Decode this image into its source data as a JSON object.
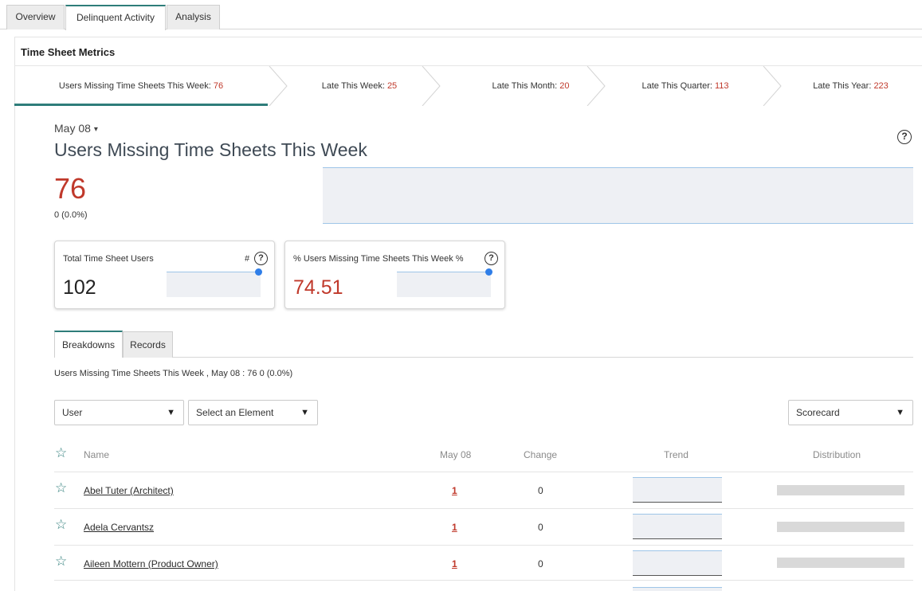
{
  "tabs": [
    "Overview",
    "Delinquent Activity",
    "Analysis"
  ],
  "panel_title": "Time Sheet Metrics",
  "metrics": [
    {
      "label": "Users Missing Time Sheets This Week: ",
      "value": "76"
    },
    {
      "label": "Late This Week: ",
      "value": "25"
    },
    {
      "label": "Late This Month: ",
      "value": "20"
    },
    {
      "label": "Late This Quarter: ",
      "value": "113"
    },
    {
      "label": "Late This Year: ",
      "value": "223"
    }
  ],
  "header": {
    "date": "May 08",
    "title": "Users Missing Time Sheets This Week",
    "value": "76",
    "change": "0 (0.0%)",
    "help": "?"
  },
  "cards": [
    {
      "label": "Total Time Sheet Users",
      "unit": "#",
      "value": "102"
    },
    {
      "label": "% Users Missing Time Sheets This Week %",
      "unit": "",
      "value": "74.51"
    }
  ],
  "subtabs": [
    "Breakdowns",
    "Records"
  ],
  "summary": "Users Missing Time Sheets This Week , May 08 : 76 0 (0.0%)",
  "selects": {
    "breakdown": "User",
    "element": "Select an Element",
    "view": "Scorecard"
  },
  "table": {
    "columns": [
      "Name",
      "May 08",
      "Change",
      "Trend",
      "Distribution"
    ],
    "rows": [
      {
        "name": "Abel Tuter (Architect)",
        "value": "1",
        "change": "0"
      },
      {
        "name": "Adela Cervantsz",
        "value": "1",
        "change": "0"
      },
      {
        "name": "Aileen Mottern (Product Owner)",
        "value": "1",
        "change": "0"
      }
    ]
  },
  "colors": {
    "accent": "#2e7d7a",
    "value_red": "#c0392b",
    "dot_blue": "#2f7ee8"
  }
}
